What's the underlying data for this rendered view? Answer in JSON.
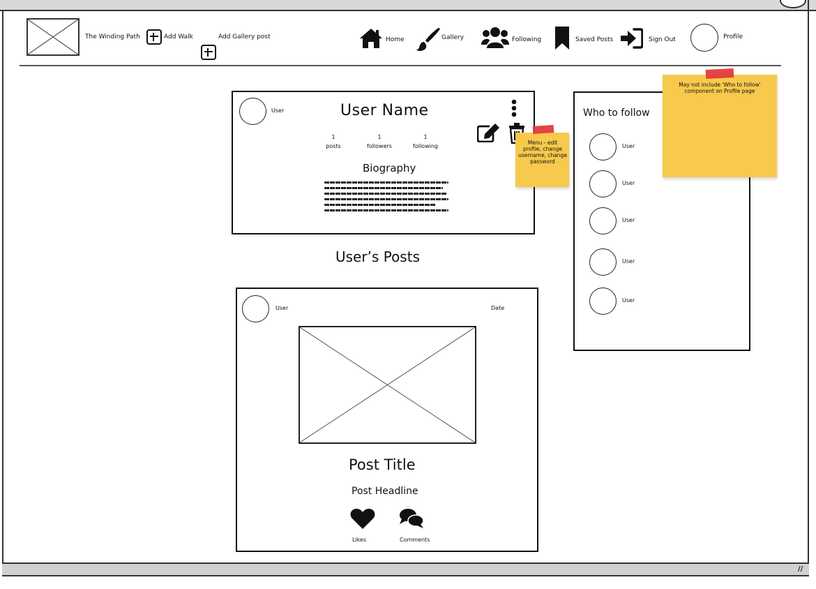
{
  "nav": {
    "brand": "The Winding Path",
    "add_walk": "Add Walk",
    "add_gallery": "Add Gallery post",
    "home": "Home",
    "gallery": "Gallery",
    "following": "Following",
    "saved_posts": "Saved Posts",
    "sign_out": "Sign Out",
    "profile": "Profile"
  },
  "profile_card": {
    "avatar_label": "User",
    "user_name": "User Name",
    "stats": [
      {
        "value": "1",
        "label": "posts"
      },
      {
        "value": "1",
        "label": "followers"
      },
      {
        "value": "1",
        "label": "following"
      }
    ],
    "bio_title": "Biography"
  },
  "posts_section": {
    "title": "User’s Posts"
  },
  "post": {
    "user_label": "User",
    "date_label": "Date",
    "title": "Post Title",
    "headline": "Post Headline",
    "likes_label": "Likes",
    "comments_label": "Comments"
  },
  "who_to_follow": {
    "title": "Who to follow",
    "users": [
      "User",
      "User",
      "User",
      "User",
      "User"
    ]
  },
  "notes": {
    "menu_note": "Menu - edit profile, change username, change password",
    "follow_note": "May not include 'Who to follow' component on Profile page"
  },
  "icons": {
    "home": "home-icon",
    "gallery": "paintbrush-icon",
    "following": "users-icon",
    "saved": "bookmark-icon",
    "signout": "sign-in-icon",
    "menu": "kebab-menu-icon",
    "edit": "edit-icon",
    "delete": "trash-icon",
    "like": "heart-icon",
    "comment": "comments-icon"
  },
  "colors": {
    "sticky": "#f7c94c",
    "tape": "#e23b3b",
    "frame": "#d9d9d9"
  }
}
